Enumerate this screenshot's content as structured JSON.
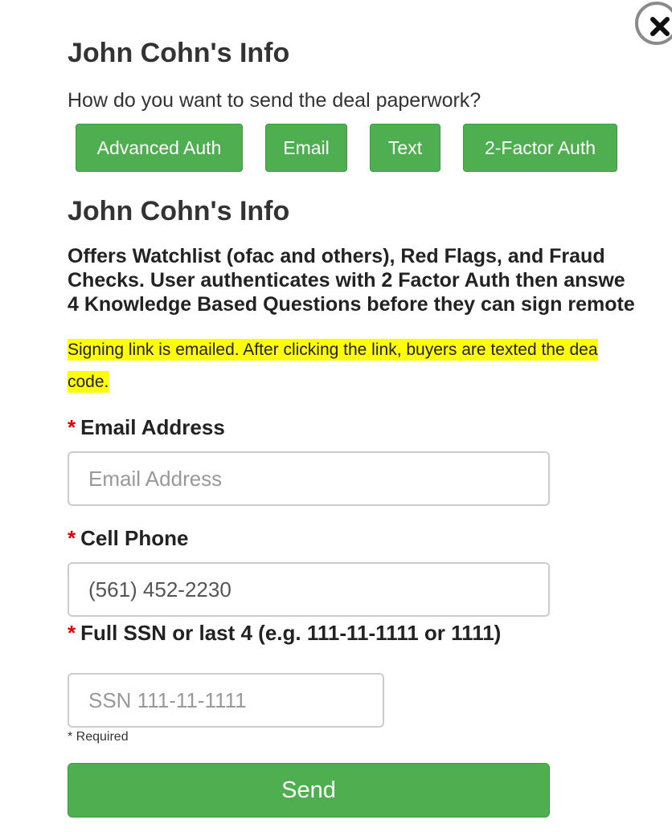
{
  "modal": {
    "title_top": "John Cohn's Info",
    "question": "How do you want to send the deal paperwork?",
    "methods": [
      {
        "label": "Advanced Auth"
      },
      {
        "label": "Email"
      },
      {
        "label": "Text"
      },
      {
        "label": "2-Factor Auth"
      }
    ],
    "title_section": "John Cohn's Info",
    "description_lines": [
      "Offers Watchlist (ofac and others), Red Flags, and Fraud",
      "Checks. User authenticates with 2 Factor Auth then answe",
      "4 Knowledge Based Questions before they can sign remote"
    ],
    "highlight_lines": [
      "Signing link is emailed. After clicking the link, buyers are texted the dea",
      "code."
    ],
    "form": {
      "email": {
        "required_marker": "*",
        "label": "Email Address",
        "value": "",
        "placeholder": "Email Address"
      },
      "phone": {
        "required_marker": "*",
        "label": "Cell Phone",
        "value": "(561) 452-2230",
        "placeholder": ""
      },
      "ssn": {
        "required_marker": "*",
        "label": "Full SSN or last 4 (e.g. 111-11-1111 or 1111)",
        "value": "",
        "placeholder": "SSN 111-11-1111"
      },
      "required_note": "* Required",
      "submit_label": "Send"
    }
  },
  "colors": {
    "button_green": "#4fae50",
    "highlight": "#ffff00",
    "required_red": "#e00000"
  },
  "icons": {
    "close": "close-icon"
  }
}
